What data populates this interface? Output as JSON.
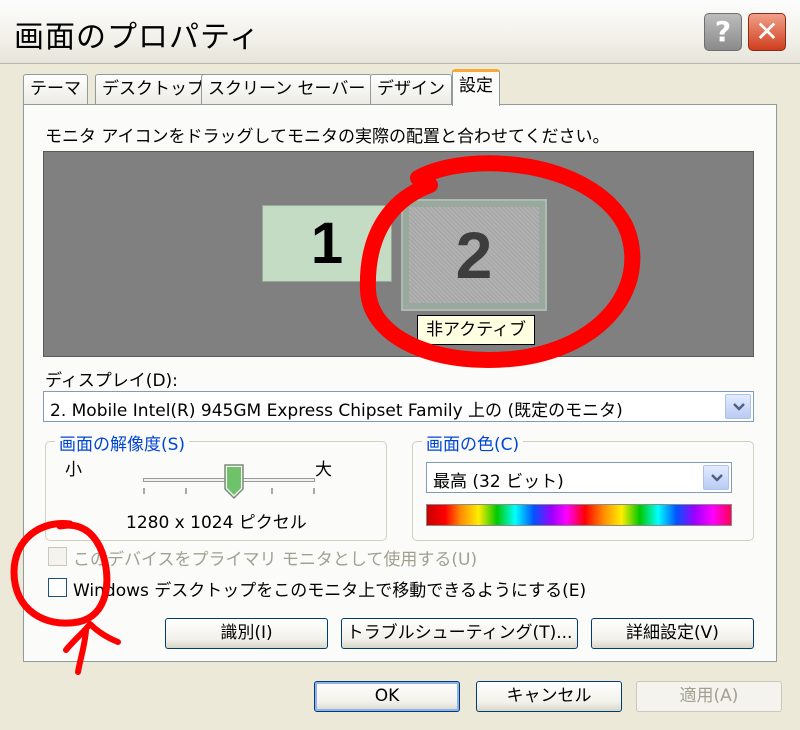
{
  "window": {
    "title": "画面のプロパティ",
    "help_label": "?",
    "close_label": "✕"
  },
  "tabs": [
    {
      "label": "テーマ",
      "active": false
    },
    {
      "label": "デスクトップ",
      "active": false
    },
    {
      "label": "スクリーン セーバー",
      "active": false
    },
    {
      "label": "デザイン",
      "active": false
    },
    {
      "label": "設定",
      "active": true
    }
  ],
  "settings": {
    "instruction": "モニタ アイコンをドラッグしてモニタの実際の配置と合わせてください。",
    "monitors": [
      {
        "number": "1",
        "active": true
      },
      {
        "number": "2",
        "active": false,
        "tooltip": "非アクティブ"
      }
    ],
    "display_label": "ディスプレイ(D):",
    "display_value": "2. Mobile Intel(R) 945GM Express Chipset Family 上の (既定のモニタ)",
    "resolution": {
      "legend": "画面の解像度(S)",
      "min_label": "小",
      "max_label": "大",
      "value_text": "1280 x 1024 ピクセル",
      "slider_fraction": 0.53
    },
    "color": {
      "legend": "画面の色(C)",
      "value": "最高 (32 ビット)"
    },
    "checkboxes": [
      {
        "label": "このデバイスをプライマリ モニタとして使用する(U)",
        "checked": false,
        "enabled": false
      },
      {
        "label": "Windows デスクトップをこのモニタ上で移動できるようにする(E)",
        "checked": false,
        "enabled": true
      }
    ],
    "buttons": {
      "identify": "識別(I)",
      "troubleshoot": "トラブルシューティング(T)...",
      "advanced": "詳細設定(V)"
    }
  },
  "dialog_buttons": {
    "ok": "OK",
    "cancel": "キャンセル",
    "apply": "適用(A)"
  },
  "colors": {
    "accent_tab": "#f8a93a",
    "legend_text": "#0046d5",
    "annotation_red": "#ff0000"
  }
}
